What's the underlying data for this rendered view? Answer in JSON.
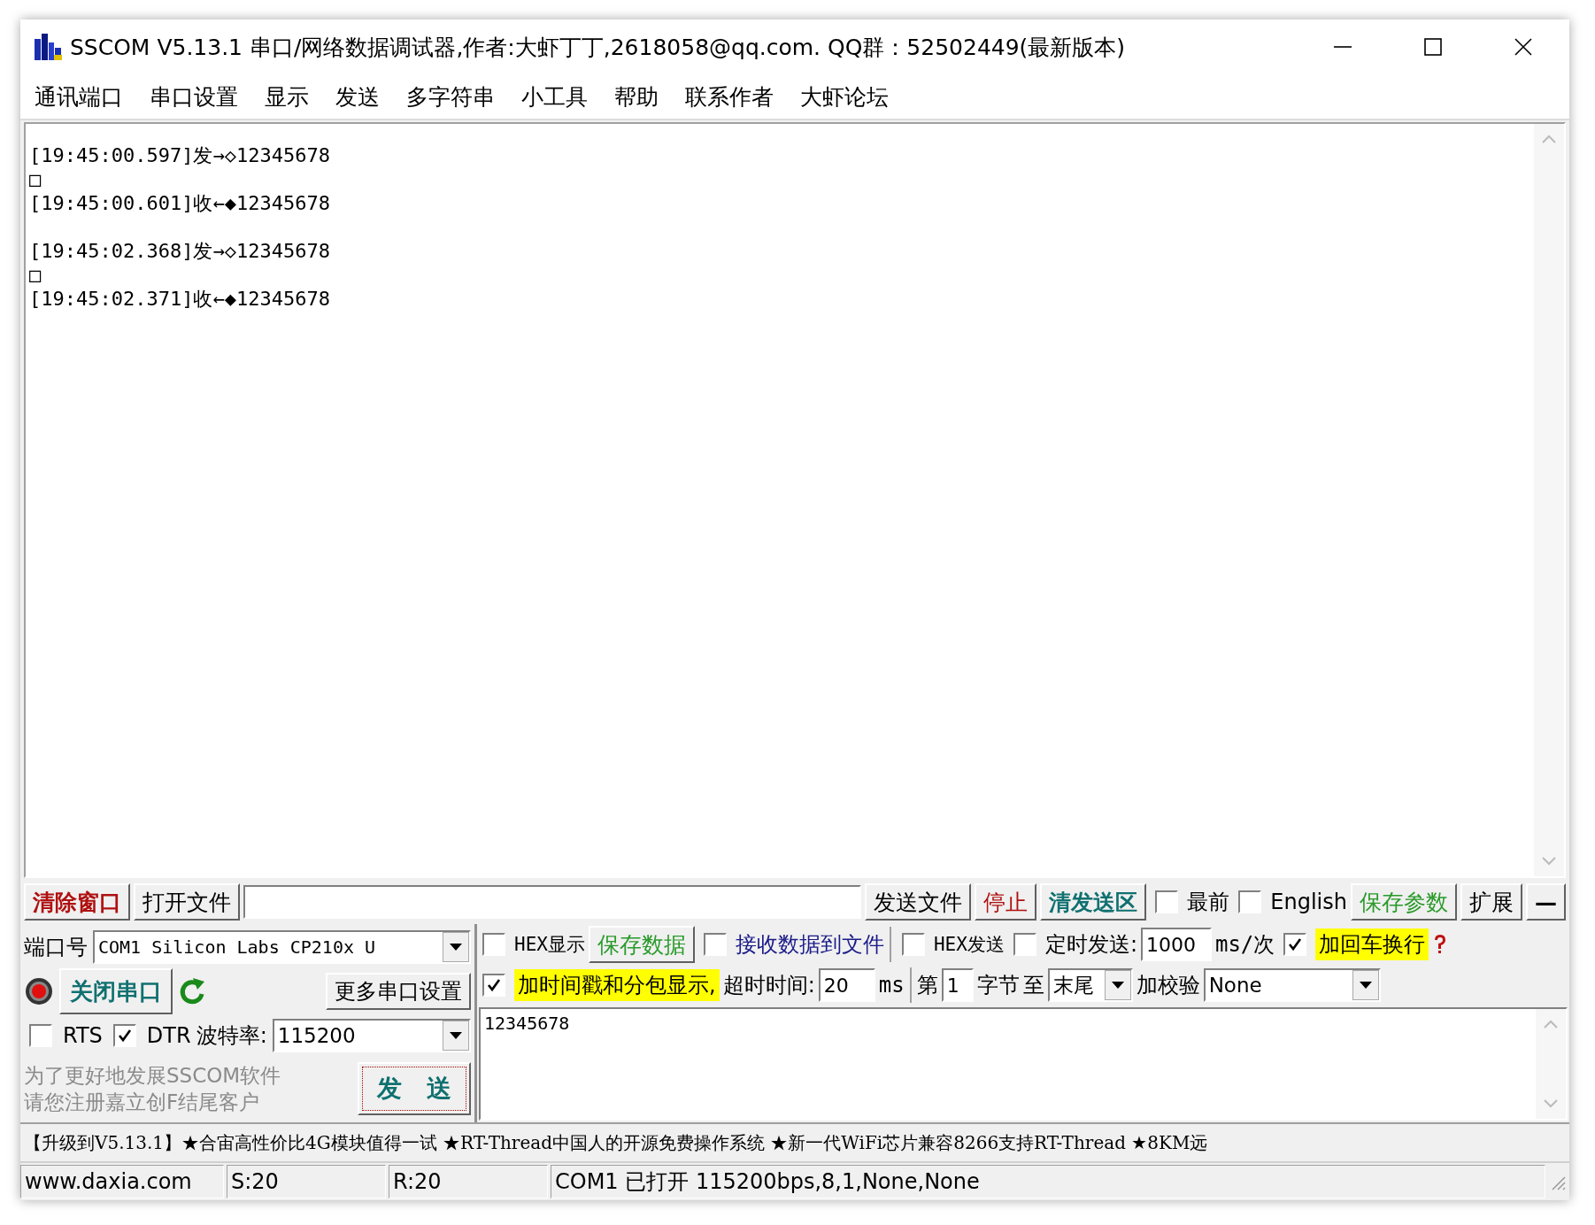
{
  "window": {
    "title": "SSCOM V5.13.1 串口/网络数据调试器,作者:大虾丁丁,2618058@qq.com. QQ群：52502449(最新版本)"
  },
  "menu": [
    "通讯端口",
    "串口设置",
    "显示",
    "发送",
    "多字符串",
    "小工具",
    "帮助",
    "联系作者",
    "大虾论坛"
  ],
  "log": {
    "exchanges": [
      {
        "lines": [
          "[19:45:00.597]发→◇12345678",
          "□",
          "[19:45:00.601]收←◆12345678"
        ]
      },
      {
        "lines": [
          "[19:45:02.368]发→◇12345678",
          "□",
          "[19:45:02.371]收←◆12345678"
        ]
      }
    ]
  },
  "toolbar": {
    "clear_window_button": "清除窗口",
    "open_file_button": "打开文件",
    "send_file_button": "发送文件",
    "stop_button": "停止",
    "clear_send_button": "清发送区",
    "topmost": {
      "label": "最前",
      "checked": false
    },
    "english": {
      "label": "English",
      "checked": false
    },
    "save_params_button": "保存参数",
    "expand_button": "扩展",
    "collapse_button": "—"
  },
  "port_panel": {
    "port_label": "端口号",
    "port_value": "COM1 Silicon Labs CP210x U",
    "port_open": true,
    "close_port_button": "关闭串口",
    "more_settings_button": "更多串口设置",
    "rts": {
      "label": "RTS",
      "checked": false
    },
    "dtr": {
      "label": "DTR",
      "checked": true
    },
    "baud_label": "波特率:",
    "baud_value": "115200",
    "promo": [
      "为了更好地发展SSCOM软件",
      "请您注册嘉立创F结尾客户"
    ],
    "send_button": "发　送"
  },
  "options": {
    "hex_display": {
      "label": "HEX显示",
      "checked": false
    },
    "save_data_button": "保存数据",
    "receive_to_file": {
      "label": "接收数据到文件",
      "checked": false
    },
    "hex_send": {
      "label": "HEX发送",
      "checked": false
    },
    "timed_send": {
      "label": "定时发送:",
      "checked": false
    },
    "interval": "1000",
    "interval_unit": "ms/次",
    "add_crlf": {
      "label": "加回车换行",
      "checked": true
    },
    "timestamp": {
      "label": "加时间戳和分包显示,",
      "checked": true
    },
    "timeout_label": "超时时间:",
    "timeout": "20",
    "timeout_unit": "ms",
    "byte_from_label": "第",
    "byte_from": "1",
    "byte_label": "字节",
    "to_label": "至",
    "byte_to": "末尾",
    "checksum_label": "加校验",
    "checksum": "None"
  },
  "send_text": "12345678",
  "ticker": "【升级到V5.13.1】★合宙高性价比4G模块值得一试 ★RT-Thread中国人的开源免费操作系统 ★新一代WiFi芯片兼容8266支持RT-Thread ★8KM远",
  "status_bar": [
    "www.daxia.com",
    "S:20",
    "R:20",
    "COM1 已打开  115200bps,8,1,None,None"
  ]
}
